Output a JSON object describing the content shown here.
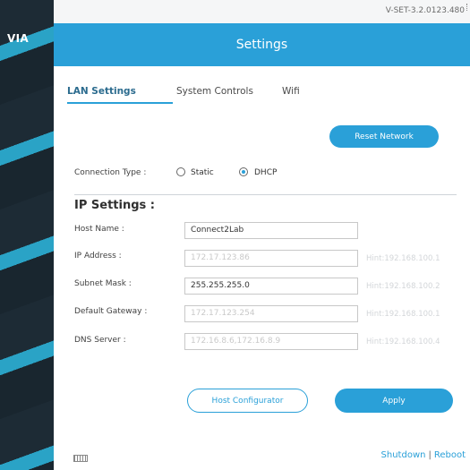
{
  "brand": {
    "logo_text": "VIA"
  },
  "version": "V-SET-3.2.0123.480",
  "header": {
    "title": "Settings"
  },
  "tabs": [
    {
      "label": "LAN Settings",
      "active": true
    },
    {
      "label": "System Controls",
      "active": false
    },
    {
      "label": "Wifi",
      "active": false
    }
  ],
  "reset_network_label": "Reset Network",
  "connection": {
    "label": "Connection Type :",
    "options": [
      {
        "label": "Static",
        "selected": false
      },
      {
        "label": "DHCP",
        "selected": true
      }
    ]
  },
  "ip_settings": {
    "title": "IP Settings :",
    "fields": [
      {
        "label": "Host Name :",
        "value": "Connect2Lab",
        "hint": ""
      },
      {
        "label": "IP Address :",
        "value": "172.17.123.86",
        "hint": "Hint:192.168.100.1"
      },
      {
        "label": "Subnet Mask :",
        "value": "255.255.255.0",
        "hint": "Hint:192.168.100.2"
      },
      {
        "label": "Default Gateway :",
        "value": "172.17.123.254",
        "hint": "Hint:192.168.100.1"
      },
      {
        "label": "DNS Server :",
        "value": "172.16.8.6,172.16.8.9",
        "hint": "Hint:192.168.100.4"
      }
    ]
  },
  "buttons": {
    "host_configurator": "Host Configurator",
    "apply": "Apply"
  },
  "footer": {
    "shutdown": "Shutdown",
    "separator": "|",
    "reboot": "Reboot",
    "keyboard_icon": "keyboard-icon"
  },
  "colors": {
    "accent": "#2aa0d8",
    "sidebar_dark": "#1d2b35"
  }
}
